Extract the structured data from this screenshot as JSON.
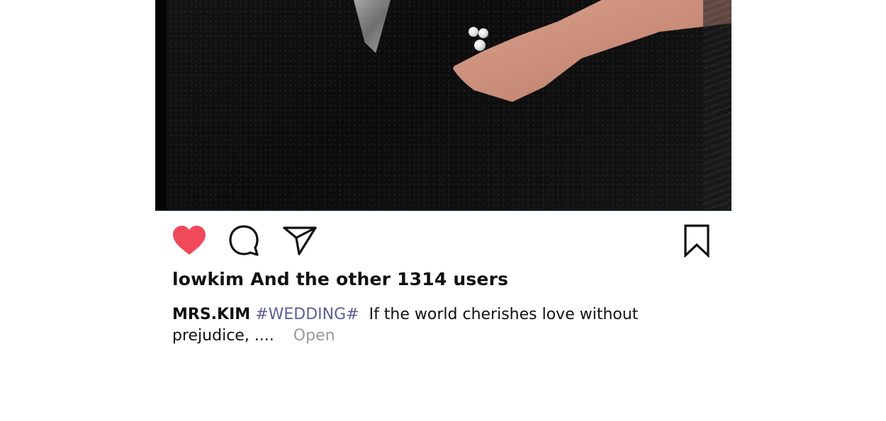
{
  "post": {
    "image_description_icon": "photo",
    "actions": {
      "like_icon": "heart-filled-icon",
      "like_color": "#f04a5a",
      "comment_icon": "speech-bubble-icon",
      "share_icon": "paper-plane-icon",
      "save_icon": "bookmark-icon"
    },
    "likes_text": "lowkim And the other 1314 users",
    "caption": {
      "username": "MRS.KIM",
      "hashtag": "#WEDDING#",
      "text": "If the world cherishes love without prejudice, ....",
      "more_label": "Open"
    },
    "colors": {
      "hashtag": "#5a5f96",
      "more": "#9a9a9a",
      "text": "#111111"
    }
  }
}
